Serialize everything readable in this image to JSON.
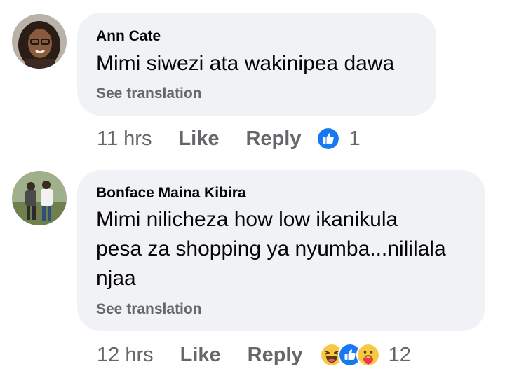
{
  "comments": [
    {
      "author": "Ann Cate",
      "text_lines": [
        "Mimi siwezi ata wakinipea dawa"
      ],
      "see_translation": "See translation",
      "time": "11 hrs",
      "like_label": "Like",
      "reply_label": "Reply",
      "reactions": [
        "like-icon"
      ],
      "reaction_count": "1"
    },
    {
      "author": "Bonface Maina Kibira",
      "text_lines": [
        "Mimi nilicheza how low ikanikula",
        "pesa za shopping ya nyumba...nililala",
        "njaa"
      ],
      "see_translation": "See translation",
      "time": "12 hrs",
      "like_label": "Like",
      "reply_label": "Reply",
      "reactions": [
        "haha-icon",
        "like-icon",
        "care-icon"
      ],
      "reaction_count": "12"
    }
  ],
  "colors": {
    "bubble": "#f0f2f5",
    "text": "#050505",
    "secondary": "#65676b",
    "like_blue": "#1877f2",
    "haha_yellow": "#f7c843"
  }
}
